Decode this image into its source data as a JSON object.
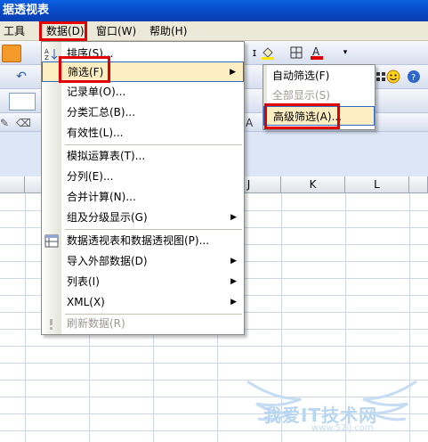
{
  "window": {
    "title": "据透视表"
  },
  "menubar": {
    "items": [
      {
        "label": "工具"
      },
      {
        "label": "数据(D)"
      },
      {
        "label": "窗口(W)"
      },
      {
        "label": "帮助(H)"
      }
    ]
  },
  "data_menu": {
    "items": [
      {
        "label": "排序(S)...",
        "disabled": false,
        "has_submenu": false
      },
      {
        "label": "筛选(F)",
        "disabled": false,
        "has_submenu": true,
        "highlighted": true
      },
      {
        "label": "记录单(O)...",
        "disabled": false,
        "has_submenu": false
      },
      {
        "label": "分类汇总(B)...",
        "disabled": false,
        "has_submenu": false
      },
      {
        "label": "有效性(L)...",
        "disabled": false,
        "has_submenu": false
      },
      {
        "label": "模拟运算表(T)...",
        "disabled": false,
        "has_submenu": false
      },
      {
        "label": "分列(E)...",
        "disabled": false,
        "has_submenu": false
      },
      {
        "label": "合并计算(N)...",
        "disabled": false,
        "has_submenu": false
      },
      {
        "label": "组及分级显示(G)",
        "disabled": false,
        "has_submenu": true
      },
      {
        "label": "数据透视表和数据透视图(P)...",
        "disabled": false,
        "has_submenu": false
      },
      {
        "label": "导入外部数据(D)",
        "disabled": false,
        "has_submenu": true
      },
      {
        "label": "列表(I)",
        "disabled": false,
        "has_submenu": true
      },
      {
        "label": "XML(X)",
        "disabled": false,
        "has_submenu": true
      },
      {
        "label": "刷新数据(R)",
        "disabled": true,
        "has_submenu": false
      }
    ]
  },
  "filter_submenu": {
    "items": [
      {
        "label": "自动筛选(F)",
        "disabled": false
      },
      {
        "label": "全部显示(S)",
        "disabled": true
      },
      {
        "label": "高级筛选(A)...",
        "disabled": false,
        "highlighted": true
      }
    ]
  },
  "sheet": {
    "columns": [
      "J",
      "K",
      "L"
    ]
  },
  "watermark": {
    "text": "我爱IT技术网",
    "url": "www.52ij.com"
  },
  "colors": {
    "title_bar": "#0846c2",
    "menu_highlight": "#ffeec2",
    "annotation_red": "#e00000"
  }
}
